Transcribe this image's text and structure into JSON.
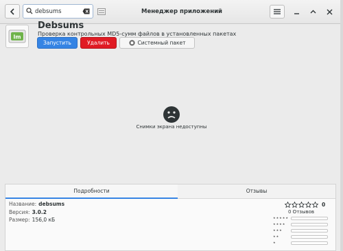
{
  "header": {
    "title": "Менеджер приложений",
    "search": {
      "value": "debsums",
      "placeholder": ""
    }
  },
  "app": {
    "name": "Debsums",
    "summary": "Проверка контрольных MD5-сумм файлов в установленных пакетах",
    "buttons": {
      "launch": "Запустить",
      "remove": "Удалить",
      "system": "Системный пакет"
    }
  },
  "screenshots": {
    "message": "Снимки экрана недоступны"
  },
  "details": {
    "tabs": {
      "details": "Подробности",
      "reviews": "Отзывы"
    },
    "name_label": "Название:",
    "name_value": "debsums",
    "version_label": "Версия:",
    "version_value": "3.0.2",
    "size_label": "Размер:",
    "size_value": "156,0 кБ"
  },
  "rating": {
    "count": "0",
    "reviews_text": "0 Отзывов",
    "histogram": [
      {
        "stars": "★★★★★",
        "fraction": 0
      },
      {
        "stars": "★★★★",
        "fraction": 0
      },
      {
        "stars": "★★★",
        "fraction": 0
      },
      {
        "stars": "★★",
        "fraction": 0
      },
      {
        "stars": "★",
        "fraction": 0
      }
    ]
  },
  "colors": {
    "accent": "#3584e4",
    "destructive": "#e01b24",
    "app_icon_green": "#6fb34a"
  }
}
